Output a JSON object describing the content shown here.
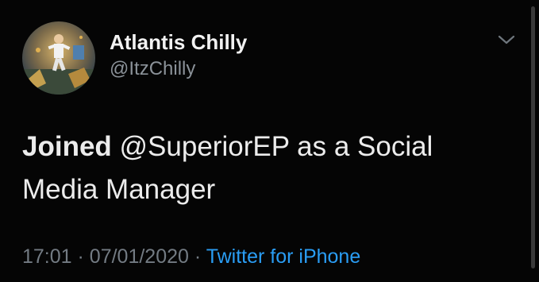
{
  "author": {
    "display_name": "Atlantis Chilly",
    "handle": "@ItzChilly",
    "avatar_icon": "profile-avatar"
  },
  "tweet": {
    "text_bold": "Joined",
    "text_rest": " @SuperiorEP as a Social Media Manager",
    "time": "17:01",
    "separator1": "·",
    "date": "07/01/2020",
    "separator2": "·",
    "source": "Twitter for iPhone"
  },
  "icons": {
    "menu": "chevron-down-icon"
  },
  "colors": {
    "background": "#050505",
    "primary_text": "#ececec",
    "secondary_text": "#8b9299",
    "link": "#2a9df4"
  }
}
